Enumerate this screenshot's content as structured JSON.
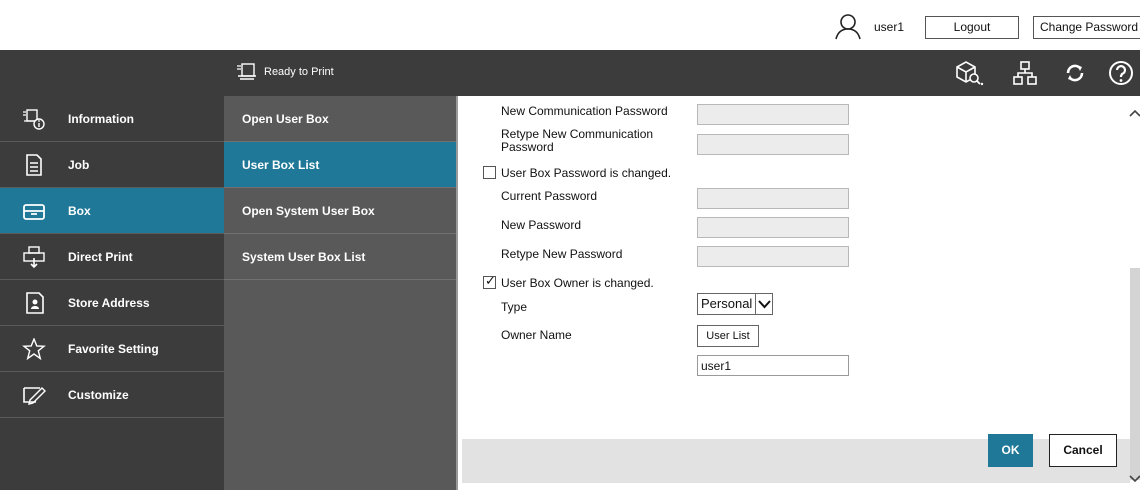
{
  "user": {
    "name": "user1",
    "logout_label": "Logout",
    "change_password_label": "Change Password"
  },
  "header": {
    "status": "Ready to Print",
    "icons": [
      "box-search-icon",
      "network-icon",
      "refresh-icon",
      "help-icon"
    ]
  },
  "sidebar": {
    "items": [
      {
        "label": "Information",
        "icon": "information-icon"
      },
      {
        "label": "Job",
        "icon": "job-icon"
      },
      {
        "label": "Box",
        "icon": "box-icon",
        "active": true
      },
      {
        "label": "Direct Print",
        "icon": "direct-print-icon"
      },
      {
        "label": "Store Address",
        "icon": "store-address-icon"
      },
      {
        "label": "Favorite Setting",
        "icon": "star-icon"
      },
      {
        "label": "Customize",
        "icon": "customize-icon"
      }
    ]
  },
  "submenu": {
    "items": [
      {
        "label": "Open User Box"
      },
      {
        "label": "User Box List",
        "active": true
      },
      {
        "label": "Open System User Box"
      },
      {
        "label": "System User Box List"
      }
    ]
  },
  "form": {
    "new_comm_password_label": "New Communication Password",
    "retype_comm_password_label": "Retype New Communication Password",
    "box_password_changed_label": "User Box Password is changed.",
    "box_password_changed": false,
    "current_password_label": "Current Password",
    "new_password_label": "New Password",
    "retype_new_password_label": "Retype New Password",
    "owner_changed_label": "User Box Owner is changed.",
    "owner_changed": true,
    "type_label": "Type",
    "type_value": "Personal",
    "owner_name_label": "Owner Name",
    "user_list_button": "User List",
    "owner_name_value": "user1"
  },
  "actions": {
    "ok_label": "OK",
    "cancel_label": "Cancel"
  },
  "colors": {
    "accent": "#1f7898",
    "dark": "#3c3c3c",
    "submenu": "#595959"
  }
}
